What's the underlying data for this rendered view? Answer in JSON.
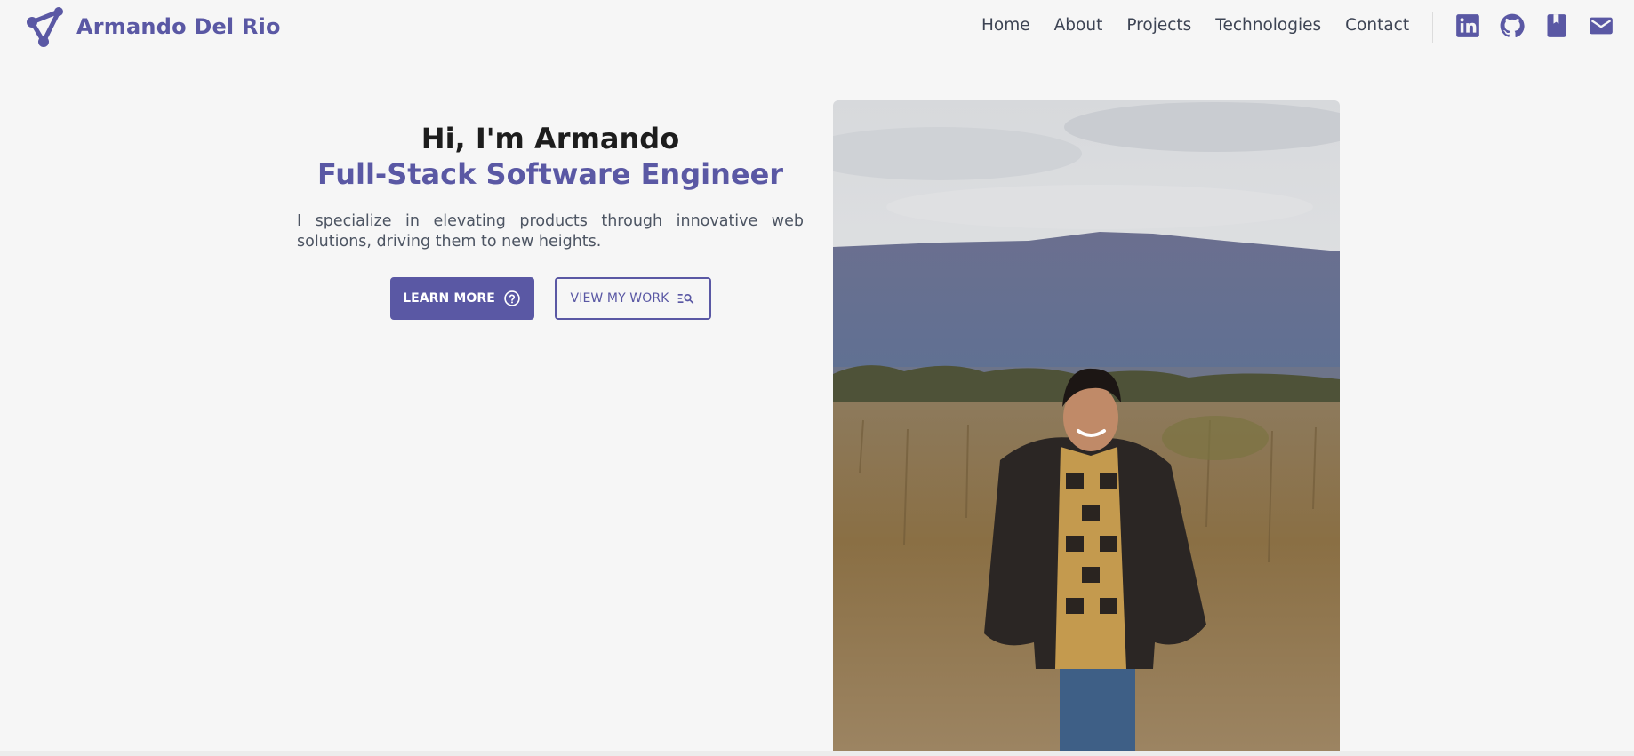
{
  "brand": {
    "name": "Armando Del Rio",
    "logo_icon": "triangle-nodes-icon",
    "accent_color": "#5a58a4"
  },
  "nav": {
    "items": [
      "Home",
      "About",
      "Projects",
      "Technologies",
      "Contact"
    ]
  },
  "socials": [
    {
      "icon": "linkedin-icon"
    },
    {
      "icon": "github-icon"
    },
    {
      "icon": "book-icon"
    },
    {
      "icon": "mail-icon"
    }
  ],
  "hero": {
    "greeting": "Hi, I'm Armando",
    "role": "Full-Stack Software Engineer",
    "tagline": "I specialize in elevating products through innovative web solutions, driving them to new heights.",
    "primary_button": {
      "label": "LEARN MORE",
      "icon": "question-circle-icon"
    },
    "secondary_button": {
      "label": "VIEW MY WORK",
      "icon": "list-search-icon"
    }
  },
  "photo": {
    "subject": "portrait-photo"
  }
}
